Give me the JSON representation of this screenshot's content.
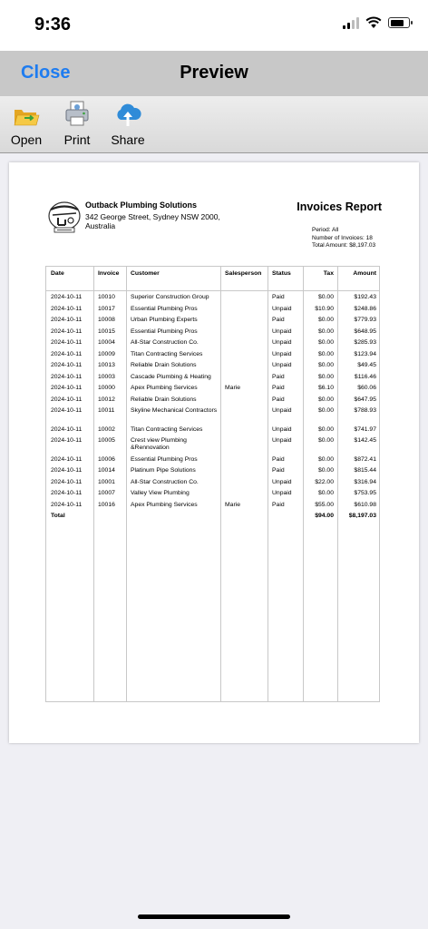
{
  "status_bar": {
    "time": "9:36"
  },
  "nav": {
    "close_label": "Close",
    "title": "Preview"
  },
  "toolbar": {
    "open_label": "Open",
    "print_label": "Print",
    "share_label": "Share"
  },
  "report": {
    "company_name": "Outback Plumbing Solutions",
    "company_address": "342 George Street, Sydney NSW 2000, Australia",
    "title": "Invoices Report",
    "period": "Period: All",
    "invoice_count": "Number of Invoices: 18",
    "total_amount": "Total Amount: $8,197.03",
    "columns": [
      "Date",
      "Invoice",
      "Customer",
      "Salesperson",
      "Status",
      "Tax",
      "Amount"
    ],
    "rows": [
      {
        "date": "2024-10-11",
        "invoice": "10010",
        "customer": "Superior Construction Group",
        "salesperson": "",
        "status": "Paid",
        "tax": "$0.00",
        "amount": "$192.43"
      },
      {
        "date": "2024-10-11",
        "invoice": "10017",
        "customer": "Essential Plumbing Pros",
        "salesperson": "",
        "status": "Unpaid",
        "tax": "$10.90",
        "amount": "$248.86"
      },
      {
        "date": "2024-10-11",
        "invoice": "10008",
        "customer": "Urban Plumbing Experts",
        "salesperson": "",
        "status": "Paid",
        "tax": "$0.00",
        "amount": "$779.93"
      },
      {
        "date": "2024-10-11",
        "invoice": "10015",
        "customer": "Essential Plumbing Pros",
        "salesperson": "",
        "status": "Unpaid",
        "tax": "$0.00",
        "amount": "$648.95"
      },
      {
        "date": "2024-10-11",
        "invoice": "10004",
        "customer": "All-Star Construction Co.",
        "salesperson": "",
        "status": "Unpaid",
        "tax": "$0.00",
        "amount": "$285.93"
      },
      {
        "date": "2024-10-11",
        "invoice": "10009",
        "customer": "Titan Contracting Services",
        "salesperson": "",
        "status": "Unpaid",
        "tax": "$0.00",
        "amount": "$123.94"
      },
      {
        "date": "2024-10-11",
        "invoice": "10013",
        "customer": "Reliable Drain Solutions",
        "salesperson": "",
        "status": "Unpaid",
        "tax": "$0.00",
        "amount": "$49.45"
      },
      {
        "date": "2024-10-11",
        "invoice": "10003",
        "customer": "Cascade Plumbing & Heating",
        "salesperson": "",
        "status": "Paid",
        "tax": "$0.00",
        "amount": "$116.46"
      },
      {
        "date": "2024-10-11",
        "invoice": "10000",
        "customer": "Apex Plumbing Services",
        "salesperson": "Marie",
        "status": "Paid",
        "tax": "$6.10",
        "amount": "$60.06"
      },
      {
        "date": "2024-10-11",
        "invoice": "10012",
        "customer": "Reliable Drain Solutions",
        "salesperson": "",
        "status": "Paid",
        "tax": "$0.00",
        "amount": "$647.95"
      },
      {
        "date": "2024-10-11",
        "invoice": "10011",
        "customer": "Skyline Mechanical Contractors",
        "salesperson": "",
        "status": "Unpaid",
        "tax": "$0.00",
        "amount": "$788.93"
      },
      {
        "date": "2024-10-11",
        "invoice": "10002",
        "customer": "Titan Contracting Services",
        "salesperson": "",
        "status": "Unpaid",
        "tax": "$0.00",
        "amount": "$741.97"
      },
      {
        "date": "2024-10-11",
        "invoice": "10005",
        "customer": "Crest view Plumbing &Rennovation",
        "salesperson": "",
        "status": "Unpaid",
        "tax": "$0.00",
        "amount": "$142.45"
      },
      {
        "date": "2024-10-11",
        "invoice": "10006",
        "customer": "Essential Plumbing Pros",
        "salesperson": "",
        "status": "Paid",
        "tax": "$0.00",
        "amount": "$872.41"
      },
      {
        "date": "2024-10-11",
        "invoice": "10014",
        "customer": "Platinum Pipe Solutions",
        "salesperson": "",
        "status": "Paid",
        "tax": "$0.00",
        "amount": "$815.44"
      },
      {
        "date": "2024-10-11",
        "invoice": "10001",
        "customer": "All-Star Construction Co.",
        "salesperson": "",
        "status": "Unpaid",
        "tax": "$22.00",
        "amount": "$316.94"
      },
      {
        "date": "2024-10-11",
        "invoice": "10007",
        "customer": "Valley View Plumbing",
        "salesperson": "",
        "status": "Unpaid",
        "tax": "$0.00",
        "amount": "$753.95"
      },
      {
        "date": "2024-10-11",
        "invoice": "10016",
        "customer": "Apex Plumbing Services",
        "salesperson": "Marie",
        "status": "Paid",
        "tax": "$55.00",
        "amount": "$610.98"
      }
    ],
    "total": {
      "label": "Total",
      "tax": "$94.00",
      "amount": "$8,197.03"
    }
  }
}
